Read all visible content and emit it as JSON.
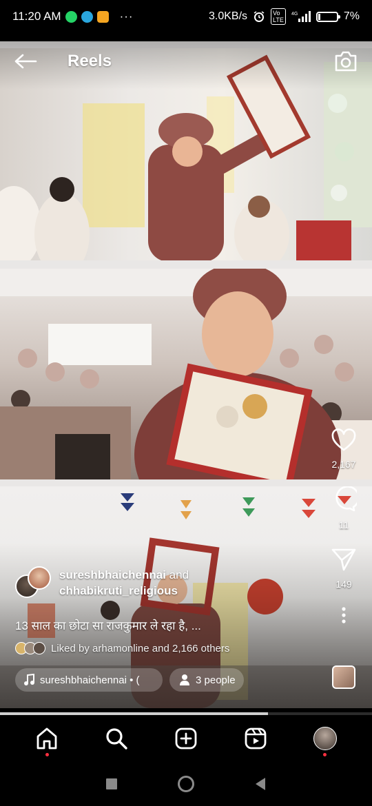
{
  "status_bar": {
    "time": "11:20 AM",
    "more": "···",
    "network_speed": "3.0KB/s",
    "battery_percent": "7%",
    "app_icons": [
      "whatsapp-icon",
      "telegram-icon",
      "notes-icon"
    ],
    "app_colors": [
      "#25d366",
      "#2aa6de",
      "#f4a521"
    ],
    "indicator_icons": [
      "alarm-icon",
      "volte-icon",
      "signal-4g-icon",
      "battery-icon"
    ]
  },
  "header": {
    "title": "Reels",
    "back_icon": "back-arrow-icon",
    "camera_icon": "camera-icon"
  },
  "actions": {
    "likes": "2,167",
    "comments": "11",
    "shares": "149",
    "icons": [
      "heart-icon",
      "comment-icon",
      "send-icon",
      "more-vertical-icon"
    ]
  },
  "post": {
    "author_1": "sureshbhaichennai",
    "and_text": "and",
    "author_2": "chhabikruti_religious",
    "caption": "13 साल का छोटा सा राजकुमार ले रहा है, ...",
    "liked_by_prefix": "Liked by",
    "liked_by_user": "arhamonline",
    "liked_by_suffix": "and 2,166 others",
    "audio": "sureshbhaichennai • (",
    "people": "3 people"
  },
  "playback": {
    "progress": 0.72
  },
  "nav": {
    "items": [
      "home-icon",
      "search-icon",
      "create-icon",
      "reels-icon",
      "profile-avatar"
    ],
    "active_color": "#ff3040"
  },
  "system_nav": {
    "items": [
      "recents-icon",
      "home-circle-icon",
      "back-triangle-icon"
    ]
  }
}
